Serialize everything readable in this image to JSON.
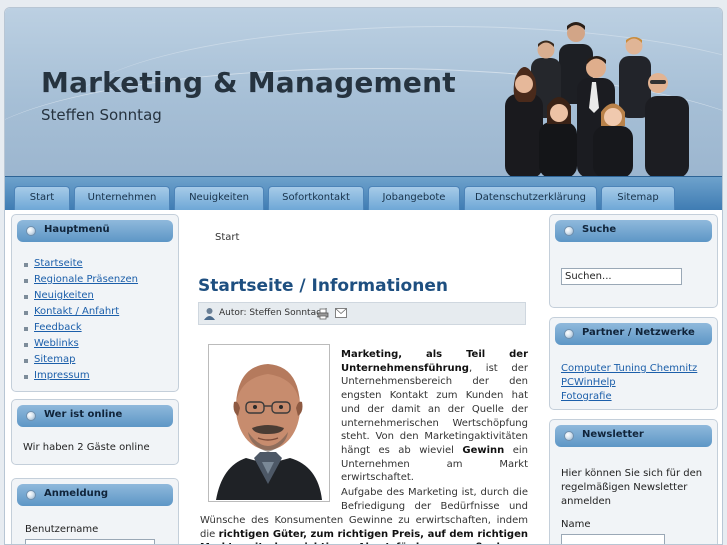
{
  "header": {
    "title": "Marketing & Management",
    "subtitle": "Steffen Sonntag"
  },
  "nav": {
    "items": [
      "Start",
      "Unternehmen",
      "Neuigkeiten",
      "Sofortkontakt",
      "Jobangebote",
      "Datenschutzerklärung",
      "Sitemap"
    ]
  },
  "left": {
    "mainmenu": {
      "title": "Hauptmenü",
      "items": [
        "Startseite",
        "Regionale Präsenzen",
        "Neuigkeiten",
        "Kontakt / Anfahrt",
        "Feedback",
        "Weblinks",
        "Sitemap",
        "Impressum"
      ]
    },
    "online": {
      "title": "Wer ist online",
      "text": "Wir haben 2 Gäste online"
    },
    "login": {
      "title": "Anmeldung",
      "username_label": "Benutzername"
    }
  },
  "main": {
    "breadcrumb": "Start",
    "title": "Startseite / Informationen",
    "author": "Autor: Steffen Sonntag |",
    "p1_bold": "Marketing, als Teil der Unternehmensführung",
    "p1_rest": ", ist der Unternehmensbereich der den engsten Kontakt zum Kunden hat und der damit an der Quelle der unternehmerischen Wertschöpfung steht. Von den Marketingaktivitäten hängt es ab wieviel",
    "p1_bold2": "Gewinn",
    "p1_end": "ein Unternehmen am Markt erwirtschaftet.",
    "p2_start": "Aufgabe des Marketing ist, durch die Befriedigung der Bedürfnisse und Wünsche des Konsumenten Gewinne zu erwirtschaften, indem die",
    "p2_bold": "richtigen Güter, zum richtigen Preis, auf dem richtigen Markt, mit den richtigen Absatzförderungsmaßnahmen plaziert werden."
  },
  "right": {
    "search": {
      "title": "Suche",
      "placeholder": "Suchen..."
    },
    "partners": {
      "title": "Partner / Netzwerke",
      "items": [
        "Computer Tuning Chemnitz",
        "PCWinHelp",
        "Fotografie"
      ]
    },
    "newsletter": {
      "title": "Newsletter",
      "text": "Hier können Sie sich für den regelmäßigen Newsletter anmelden",
      "name_label": "Name"
    }
  }
}
